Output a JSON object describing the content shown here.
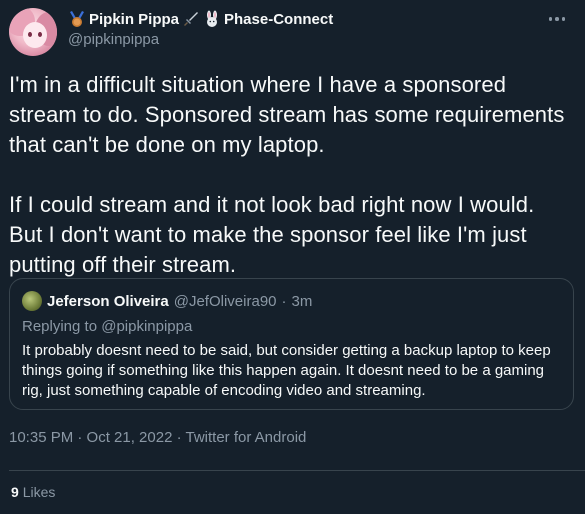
{
  "author": {
    "display_name": "Pipkin Pippa",
    "channel_name": "Phase-Connect",
    "handle": "@pipkinpippa",
    "icons": [
      "medal-icon",
      "sword-icon",
      "bunny-icon"
    ]
  },
  "tweet": {
    "paragraphs": [
      "I'm in a difficult situation where I have a sponsored stream to do. Sponsored stream has some requirements that can't be done on my laptop.",
      "If I could stream and it not look bad right now I would. But I don't want to make the sponsor feel like I'm just putting off their stream."
    ],
    "timestamp": "10:35 PM · Oct 21, 2022 · Twitter for Android"
  },
  "quote": {
    "name": "Jeferson Oliveira",
    "handle": "@JefOliveira90",
    "separator": "·",
    "age": "3m",
    "replying_to": "Replying to @pipkinpippa",
    "text": "It probably doesnt need to be said, but consider getting a backup laptop to keep things going if something like this happen again. It doesnt need to be a gaming rig, just something capable of encoding video and streaming."
  },
  "stats": {
    "likes_count": "9",
    "likes_label": "Likes"
  },
  "colors": {
    "background": "#15202b",
    "text": "#f7f9f9",
    "muted": "#8b98a5",
    "border": "#38444d"
  }
}
